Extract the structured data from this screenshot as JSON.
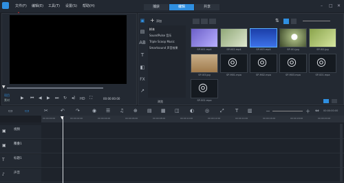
{
  "menu": [
    "文件(F)",
    "编辑(E)",
    "工具(T)",
    "设置(S)",
    "帮助(H)"
  ],
  "tabs": [
    "捕获",
    "编辑",
    "共享"
  ],
  "active_tab": 1,
  "library": {
    "add_label": "添加",
    "folders": [
      "样本",
      "SoundPulse 音乐",
      "Triple Scoop Music",
      "Smartsound 声音效果"
    ],
    "selected_folder": 0,
    "browse_label": "浏览",
    "thumbnails": [
      {
        "caption": "SP-V01.mp4",
        "kind": "video-purple"
      },
      {
        "caption": "SP-V02.mp4",
        "kind": "video-green"
      },
      {
        "caption": "SP-V03.mp4",
        "kind": "video-blue"
      },
      {
        "caption": "SP-I01.jpg",
        "kind": "image-dandelion"
      },
      {
        "caption": "SP-I02.jpg",
        "kind": "image-green"
      },
      {
        "caption": "SP-I03.jpg",
        "kind": "image-desert"
      },
      {
        "caption": "SP-M01.mpa",
        "kind": "audio"
      },
      {
        "caption": "SP-M02.mpa",
        "kind": "audio"
      },
      {
        "caption": "SP-M03.mpa",
        "kind": "audio"
      },
      {
        "caption": "SP-S01.mpa",
        "kind": "audio"
      },
      {
        "caption": "SP-S02.mpa",
        "kind": "audio"
      }
    ]
  },
  "preview": {
    "project_label": "项目",
    "clip_label": "素材",
    "hd_label": "HD",
    "timecode": "00:00:00:00"
  },
  "timeline": {
    "ticks": [
      "00:00:00:00",
      "00:00:02:00",
      "00:00:04:00",
      "00:00:06:00",
      "00:00:08:00",
      "00:00:10:00",
      "00:00:12:00",
      "00:00:14:00",
      "00:00:16:00",
      "00:00:18:00",
      "00:00:20:00"
    ],
    "tracks": [
      "视频",
      "覆叠1",
      "标题1",
      "声音"
    ]
  },
  "colors": {
    "accent": "#2f8fe0",
    "arrow": "#d62828"
  }
}
